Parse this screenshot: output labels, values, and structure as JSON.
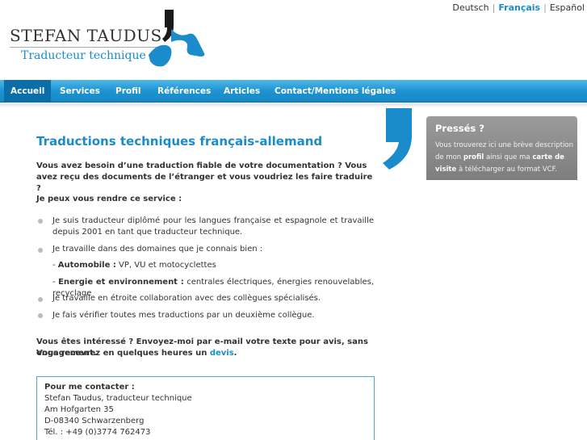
{
  "languages": [
    {
      "label": "Deutsch",
      "active": false
    },
    {
      "label": "Français",
      "active": true
    },
    {
      "label": "Español",
      "active": false
    }
  ],
  "logo": {
    "name": "STEFAN TAUDUS",
    "subtitle": "Traducteur technique",
    "colors": {
      "dark": "#1a1a1a",
      "blue": "#1a8ccc"
    }
  },
  "nav": {
    "items": [
      "Accueil",
      "Services",
      "Profil",
      "Références",
      "Articles",
      "Contact/Mentions légales"
    ],
    "active_index": 0
  },
  "main": {
    "title": "Traductions techniques français-allemand",
    "intro": "Vous avez besoin d’une traduction fiable de votre documentation ? Vous avez reçu des documents de l’étranger et vous voudriez les faire traduire ?",
    "service_heading": "Je peux vous rendre ce service :",
    "bullet1": "Je suis traducteur diplômé pour les langues française et espagnole et travaille depuis 2001 en tant que traducteur technique.",
    "bullet2": "Je travaille dans des domaines que je connais bien :",
    "domain1_label": "Automobile :",
    "domain1_text": " VP, VU et motocyclettes",
    "domain2_label": "Energie et environnement :",
    "domain2_text": " centrales électriques, énergies renouvelables, recyclage",
    "bullet3": "Je travaille en étroite collaboration avec des collègues spécialisés.",
    "bullet4": "Je fais vérifier toutes mes traductions par un deuxième collègue.",
    "cta_line1": "Vous êtes intéressé ? Envoyez-moi par e-mail votre texte pour avis, sans engagement.",
    "cta_line2_pre": "Vous recevrez en quelques heures un ",
    "cta_link": "devis",
    "cta_line2_post": "."
  },
  "contact": {
    "heading": "Pour me contacter :",
    "name": "Stefan Taudus, traducteur technique",
    "street": "Am Hofgarten 35",
    "city": "D-08340 Schwarzenberg",
    "phone": "Tél. : +49 (0)3774 762473"
  },
  "sidebar": {
    "title": "Pressés ?",
    "text_pre": "Vous trouverez ici une brève description de mon ",
    "text_profil": "profil",
    "text_mid": " ainsi que ma ",
    "text_carte": "carte de visite",
    "text_post": " à télécharger au format VCF."
  }
}
